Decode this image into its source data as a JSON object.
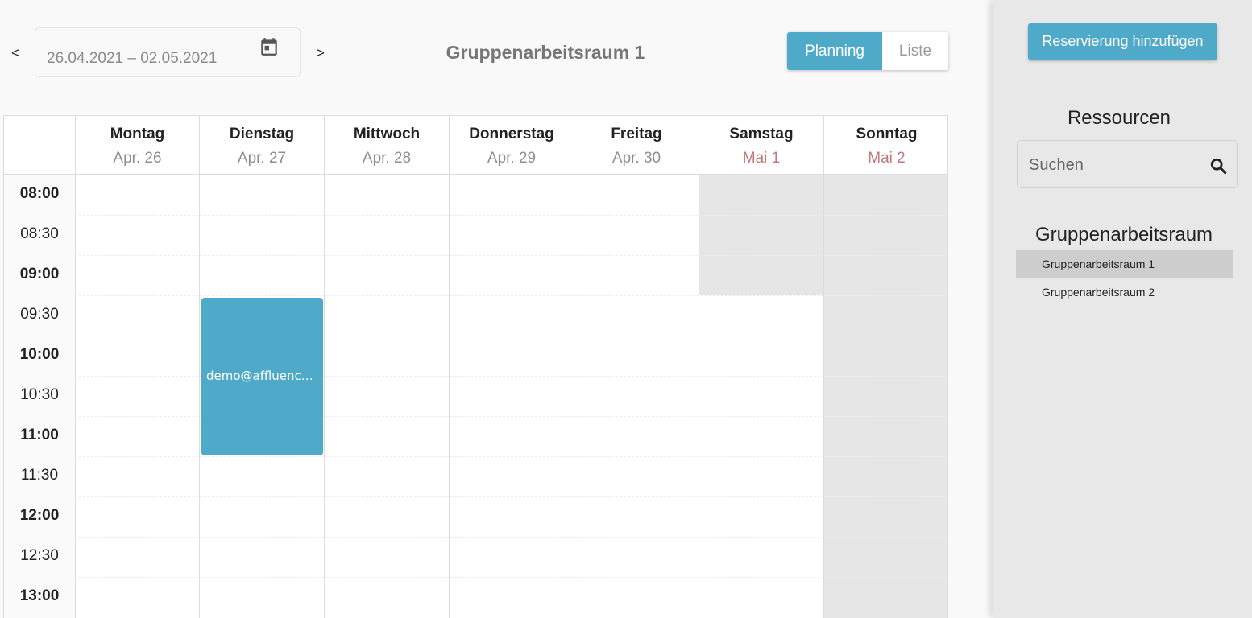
{
  "header": {
    "prev_label": "<",
    "next_label": ">",
    "date_range": "26.04.2021 – 02.05.2021",
    "calendar_icon": "calendar-icon",
    "title": "Gruppenarbeitsraum 1",
    "view_tabs": [
      {
        "label": "Planning",
        "active": true
      },
      {
        "label": "Liste",
        "active": false
      }
    ]
  },
  "calendar": {
    "days": [
      {
        "day": "Montag",
        "date": "Apr. 26",
        "weekend": false
      },
      {
        "day": "Dienstag",
        "date": "Apr. 27",
        "weekend": false
      },
      {
        "day": "Mittwoch",
        "date": "Apr. 28",
        "weekend": false
      },
      {
        "day": "Donnerstag",
        "date": "Apr. 29",
        "weekend": false
      },
      {
        "day": "Freitag",
        "date": "Apr. 30",
        "weekend": false
      },
      {
        "day": "Samstag",
        "date": "Mai 1",
        "weekend": true
      },
      {
        "day": "Sonntag",
        "date": "Mai 2",
        "weekend": true
      }
    ],
    "times": [
      "08:00",
      "08:30",
      "09:00",
      "09:30",
      "10:00",
      "10:30",
      "11:00",
      "11:30",
      "12:00",
      "12:30",
      "13:00"
    ],
    "events": [
      {
        "label": "demo@affluences.com",
        "day": "Dienstag",
        "start": "09:30",
        "end": "11:30"
      }
    ]
  },
  "sidebar": {
    "add_button": "Reservierung hinzufügen",
    "resources_title": "Ressourcen",
    "search_placeholder": "Suchen",
    "search_icon": "search-icon",
    "group_title": "Gruppenarbeitsraum",
    "items": [
      {
        "label": "Gruppenarbeitsraum 1",
        "selected": true
      },
      {
        "label": "Gruppenarbeitsraum 2",
        "selected": false
      }
    ]
  },
  "colors": {
    "accent": "#4eaac8",
    "weekend_date": "#c07878",
    "closed": "#e6e6e6"
  }
}
